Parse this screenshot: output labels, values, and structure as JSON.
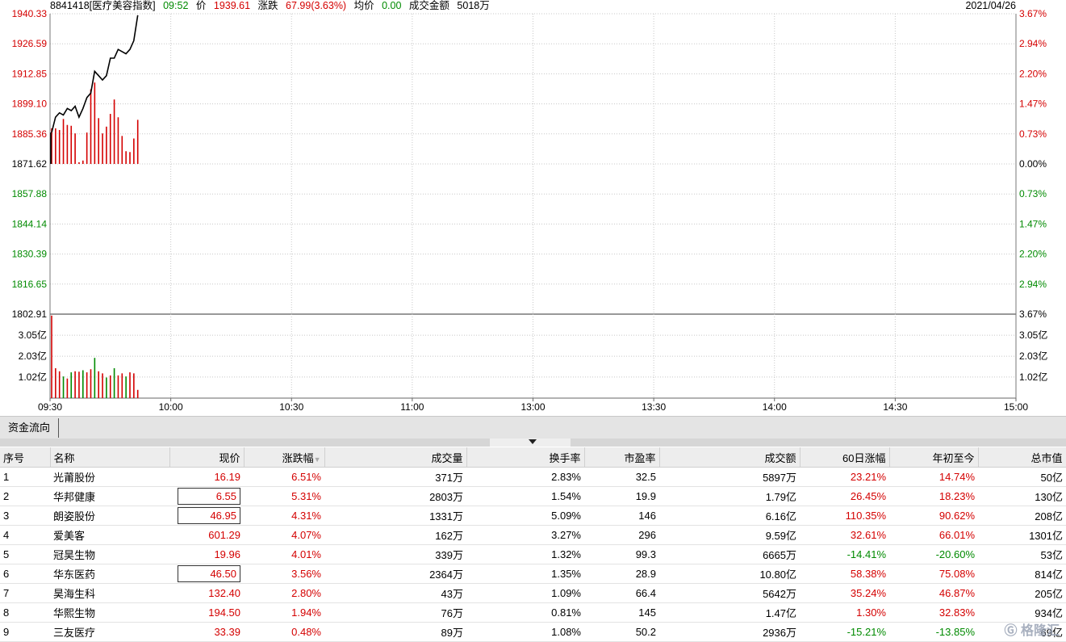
{
  "header": {
    "code": "8841418[医疗美容指数]",
    "time": "09:52",
    "price_label": "价",
    "price": "1939.61",
    "change_label": "涨跌",
    "change": "67.99(3.63%)",
    "avg_label": "均价",
    "avg": "0.00",
    "amount_label": "成交金额",
    "amount": "5018万",
    "date": "2021/04/26"
  },
  "chart_data": {
    "type": "line",
    "title": "",
    "base_price": 1871.62,
    "ylim": [
      1802.91,
      1940.33
    ],
    "y_left_ticks": [
      "1940.33",
      "1926.59",
      "1912.85",
      "1899.10",
      "1885.36",
      "1871.62",
      "1857.88",
      "1844.14",
      "1830.39",
      "1816.65",
      "1802.91"
    ],
    "y_right_ticks": [
      "3.67%",
      "2.94%",
      "2.20%",
      "1.47%",
      "0.73%",
      "0.00%",
      "0.73%",
      "1.47%",
      "2.20%",
      "2.94%",
      "3.67%"
    ],
    "x_ticks": [
      "09:30",
      "10:00",
      "10:30",
      "11:00",
      "13:00",
      "13:30",
      "14:00",
      "14:30",
      "15:00"
    ],
    "vol_ticks": [
      "3.05亿",
      "2.03亿",
      "1.02亿"
    ],
    "vol_max_yi": 4.07,
    "price_series": {
      "x_minutes": [
        0,
        1,
        2,
        3,
        4,
        5,
        6,
        7,
        8,
        9,
        10,
        11,
        12,
        13,
        14,
        15,
        16,
        17,
        18,
        19,
        20,
        21,
        22
      ],
      "values": [
        1886,
        1893,
        1895,
        1894,
        1897,
        1896,
        1898,
        1893,
        1897,
        1902,
        1904,
        1914,
        1912,
        1910,
        1912,
        1920,
        1920,
        1924,
        1923,
        1922,
        1924,
        1928,
        1939.61
      ]
    },
    "diff_bars": {
      "x_minutes": [
        0,
        1,
        2,
        3,
        4,
        5,
        6,
        7,
        8,
        9,
        10,
        11,
        12,
        13,
        14,
        15,
        16,
        17,
        18,
        19,
        20,
        21,
        22
      ],
      "values": [
        4.2,
        4.2,
        4.0,
        5.3,
        4.6,
        4.5,
        3.6,
        0.2,
        0.4,
        3.7,
        8.8,
        9.6,
        5.4,
        3.6,
        4.4,
        5.9,
        7.6,
        5.5,
        3.3,
        1.5,
        1.4,
        3.0,
        5.2
      ]
    },
    "volume_series": {
      "x_minutes": [
        0,
        1,
        2,
        3,
        4,
        5,
        6,
        7,
        8,
        9,
        10,
        11,
        12,
        13,
        14,
        15,
        16,
        17,
        18,
        19,
        20,
        21,
        22
      ],
      "values_yi": [
        4.0,
        1.45,
        1.3,
        1.05,
        0.95,
        1.25,
        1.3,
        1.28,
        1.35,
        1.25,
        1.4,
        1.95,
        1.3,
        1.2,
        1.0,
        1.1,
        1.45,
        1.1,
        1.2,
        1.05,
        1.25,
        1.2,
        0.4
      ],
      "colors": [
        "red",
        "red",
        "red",
        "green",
        "red",
        "green",
        "red",
        "red",
        "green",
        "red",
        "red",
        "green",
        "red",
        "red",
        "green",
        "red",
        "green",
        "red",
        "red",
        "green",
        "red",
        "red",
        "red"
      ]
    }
  },
  "panel": {
    "tab_label": "资金流向"
  },
  "table": {
    "headers": [
      "序号",
      "名称",
      "现价",
      "涨跌幅",
      "成交量",
      "换手率",
      "市盈率",
      "成交额",
      "60日涨幅",
      "年初至今",
      "总市值"
    ],
    "rows": [
      {
        "no": "1",
        "name": "光莆股份",
        "price": "16.19",
        "chg": "6.51%",
        "vol": "371万",
        "turn": "2.83%",
        "pe": "32.5",
        "amt": "5897万",
        "d60": "23.21%",
        "ytd": "14.74%",
        "cap": "50亿",
        "d60c": "red",
        "ytdc": "red",
        "boxed": false
      },
      {
        "no": "2",
        "name": "华邦健康",
        "price": "6.55",
        "chg": "5.31%",
        "vol": "2803万",
        "turn": "1.54%",
        "pe": "19.9",
        "amt": "1.79亿",
        "d60": "26.45%",
        "ytd": "18.23%",
        "cap": "130亿",
        "d60c": "red",
        "ytdc": "red",
        "boxed": true
      },
      {
        "no": "3",
        "name": "朗姿股份",
        "price": "46.95",
        "chg": "4.31%",
        "vol": "1331万",
        "turn": "5.09%",
        "pe": "146",
        "amt": "6.16亿",
        "d60": "110.35%",
        "ytd": "90.62%",
        "cap": "208亿",
        "d60c": "red",
        "ytdc": "red",
        "boxed": true
      },
      {
        "no": "4",
        "name": "爱美客",
        "price": "601.29",
        "chg": "4.07%",
        "vol": "162万",
        "turn": "3.27%",
        "pe": "296",
        "amt": "9.59亿",
        "d60": "32.61%",
        "ytd": "66.01%",
        "cap": "1301亿",
        "d60c": "red",
        "ytdc": "red",
        "boxed": false
      },
      {
        "no": "5",
        "name": "冠昊生物",
        "price": "19.96",
        "chg": "4.01%",
        "vol": "339万",
        "turn": "1.32%",
        "pe": "99.3",
        "amt": "6665万",
        "d60": "-14.41%",
        "ytd": "-20.60%",
        "cap": "53亿",
        "d60c": "green",
        "ytdc": "green",
        "boxed": false
      },
      {
        "no": "6",
        "name": "华东医药",
        "price": "46.50",
        "chg": "3.56%",
        "vol": "2364万",
        "turn": "1.35%",
        "pe": "28.9",
        "amt": "10.80亿",
        "d60": "58.38%",
        "ytd": "75.08%",
        "cap": "814亿",
        "d60c": "red",
        "ytdc": "red",
        "boxed": true
      },
      {
        "no": "7",
        "name": "昊海生科",
        "price": "132.40",
        "chg": "2.80%",
        "vol": "43万",
        "turn": "1.09%",
        "pe": "66.4",
        "amt": "5642万",
        "d60": "35.24%",
        "ytd": "46.87%",
        "cap": "205亿",
        "d60c": "red",
        "ytdc": "red",
        "boxed": false
      },
      {
        "no": "8",
        "name": "华熙生物",
        "price": "194.50",
        "chg": "1.94%",
        "vol": "76万",
        "turn": "0.81%",
        "pe": "145",
        "amt": "1.47亿",
        "d60": "1.30%",
        "ytd": "32.83%",
        "cap": "934亿",
        "d60c": "red",
        "ytdc": "red",
        "boxed": false
      },
      {
        "no": "9",
        "name": "三友医疗",
        "price": "33.39",
        "chg": "0.48%",
        "vol": "89万",
        "turn": "1.08%",
        "pe": "50.2",
        "amt": "2936万",
        "d60": "-15.21%",
        "ytd": "-13.85%",
        "cap": "69亿",
        "d60c": "green",
        "ytdc": "green",
        "boxed": false
      }
    ]
  },
  "watermark": "格隆汇",
  "colors": {
    "up": "#d40000",
    "down": "#008a00",
    "grid": "#c8c8c8"
  }
}
